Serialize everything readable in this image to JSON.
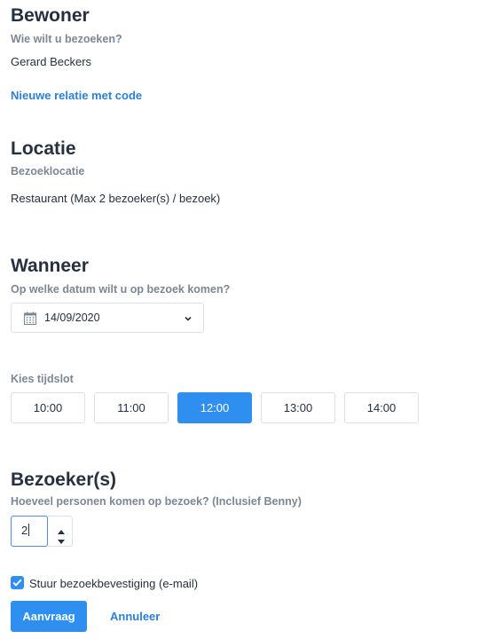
{
  "resident": {
    "heading": "Bewoner",
    "question": "Wie wilt u bezoeken?",
    "name": "Gerard Beckers",
    "new_relation_link": "Nieuwe relatie met code"
  },
  "location": {
    "heading": "Locatie",
    "label": "Bezoeklocatie",
    "value": "Restaurant (Max 2 bezoeker(s) / bezoek)"
  },
  "when": {
    "heading": "Wanneer",
    "question": "Op welke datum wilt u op bezoek komen?",
    "date_value": "14/09/2020",
    "timeslot_label": "Kies tijdslot",
    "timeslots": [
      "10:00",
      "11:00",
      "12:00",
      "13:00",
      "14:00"
    ],
    "selected_timeslot": "12:00"
  },
  "visitors": {
    "heading": "Bezoeker(s)",
    "question": "Hoeveel personen komen op bezoek? (Inclusief Benny)",
    "count": "2"
  },
  "confirmation": {
    "checked": true,
    "label": "Stuur bezoekbevestiging (e-mail)"
  },
  "actions": {
    "submit_label": "Aanvraag",
    "cancel_label": "Annuleer"
  },
  "icons": {
    "calendar": "calendar-icon",
    "chevron": "chevron-down-icon",
    "checkbox": "check-icon"
  },
  "colors": {
    "accent": "#2e8ff0",
    "link": "#2b7fd8"
  }
}
